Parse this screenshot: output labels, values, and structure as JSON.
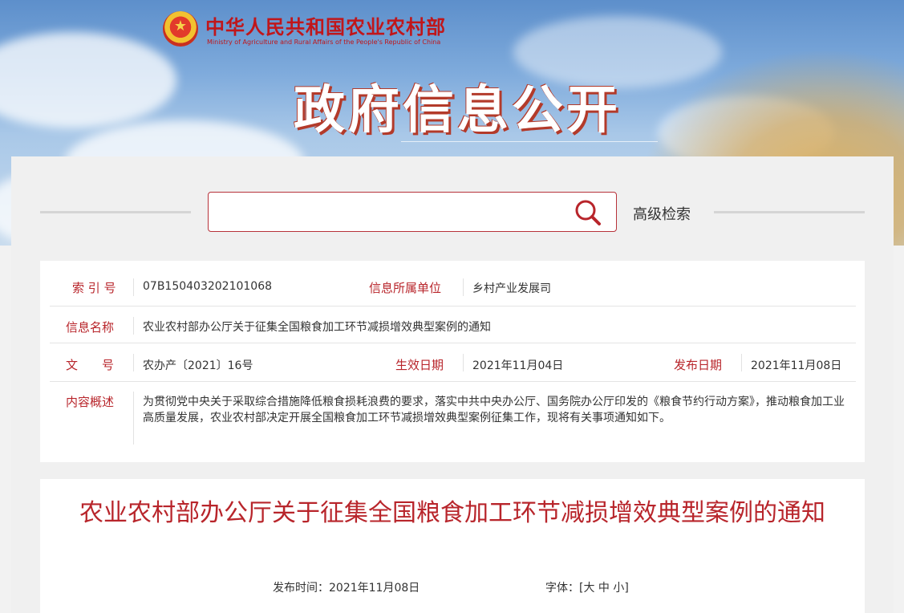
{
  "header": {
    "logo_cn": "中华人民共和国农业农村部",
    "logo_en": "Ministry of Agriculture and Rural Affairs of the People's Republic of China",
    "section_title": "政府信息公开"
  },
  "search": {
    "placeholder": "",
    "advanced_label": "高级检索"
  },
  "meta": {
    "index_label": "索 引 号",
    "index_value": "07B150403202101068",
    "unit_label": "信息所属单位",
    "unit_value": "乡村产业发展司",
    "name_label": "信息名称",
    "name_value": "农业农村部办公厅关于征集全国粮食加工环节减损增效典型案例的通知",
    "doc_label": "文　　号",
    "doc_value": "农办产〔2021〕16号",
    "effective_label": "生效日期",
    "effective_value": "2021年11月04日",
    "publish_label": "发布日期",
    "publish_value": "2021年11月08日",
    "summary_label": "内容概述",
    "summary_value": "为贯彻党中央关于采取综合措施降低粮食损耗浪费的要求，落实中共中央办公厅、国务院办公厅印发的《粮食节约行动方案》，推动粮食加工业高质量发展，农业农村部决定开展全国粮食加工环节减损增效典型案例征集工作，现将有关事项通知如下。"
  },
  "article": {
    "title": "农业农村部办公厅关于征集全国粮食加工环节减损增效典型案例的通知",
    "pubtime_label": "发布时间：",
    "pubtime_value": "2021年11月08日",
    "fontsize_label": "字体：",
    "fontsize_open": "[",
    "size_large": "大",
    "size_medium": "中",
    "size_small": "小",
    "fontsize_close": "]"
  },
  "colors": {
    "accent": "#b8252b",
    "banner_sky": "#7fabdc"
  }
}
